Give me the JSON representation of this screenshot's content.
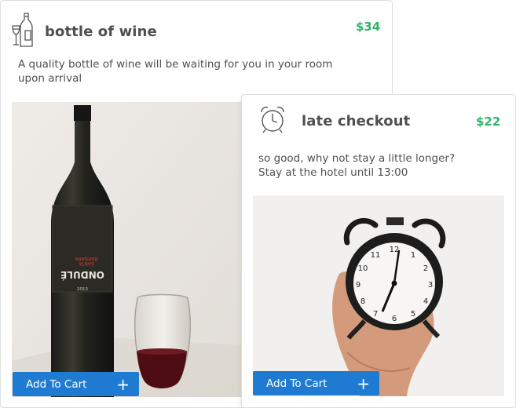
{
  "cards": [
    {
      "title": "bottle of wine",
      "price": "$34",
      "description_line1": "A quality bottle of wine will be waiting for you in your room",
      "description_line2": "upon arrival",
      "button_label": "Add To Cart",
      "icon": "wine-bottle-glass-icon",
      "label_text": "ONDULÉ",
      "label_year": "2013"
    },
    {
      "title": "late checkout",
      "price": "$22",
      "description_line1": "so good, why not stay a little longer?",
      "description_line2": "Stay at the hotel until 13:00",
      "button_label": "Add To Cart",
      "icon": "alarm-clock-icon"
    }
  ],
  "colors": {
    "price": "#2fb36b",
    "button": "#1f7bd1",
    "title": "#4f4f4f"
  }
}
